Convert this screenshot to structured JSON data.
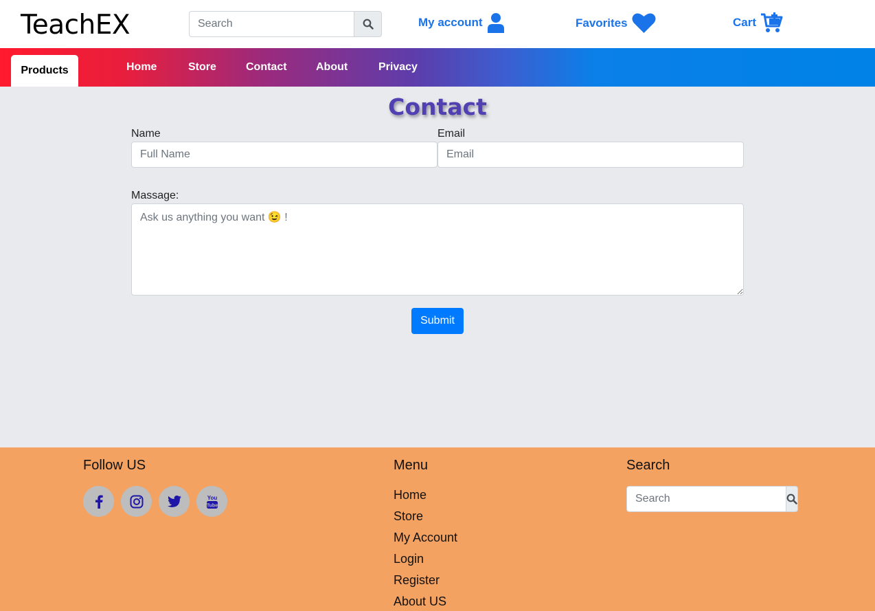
{
  "header": {
    "logo": "TeachEX",
    "search_placeholder": "Search",
    "my_account": "My account",
    "favorites": "Favorites",
    "cart": "Cart",
    "accent_color": "#1a73e8"
  },
  "nav": {
    "active": "Products",
    "items": [
      "Home",
      "Store",
      "Contact",
      "About",
      "Privacy"
    ]
  },
  "contact": {
    "title": "Contact",
    "name_label": "Name",
    "name_placeholder": "Full Name",
    "email_label": "Email",
    "email_placeholder": "Email",
    "message_label": "Massage:",
    "message_placeholder": "Ask us anything you want 😉 !",
    "submit_label": "Submit"
  },
  "footer": {
    "follow_title": "Follow US",
    "social_icons": [
      "facebook-icon",
      "instagram-icon",
      "twitter-icon",
      "youtube-icon"
    ],
    "menu_title": "Menu",
    "menu_items": [
      "Home",
      "Store",
      "My Account",
      "Login",
      "Register",
      "About US"
    ],
    "search_title": "Search",
    "search_placeholder": "Search",
    "background_color": "#f3a261"
  }
}
